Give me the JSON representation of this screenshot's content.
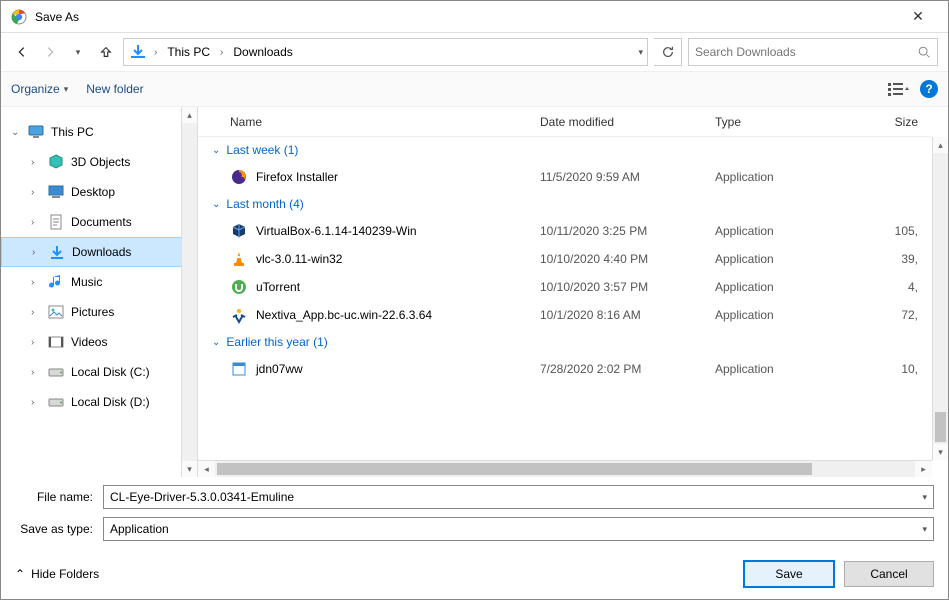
{
  "title": "Save As",
  "breadcrumb": {
    "root": "This PC",
    "item": "Downloads"
  },
  "search": {
    "placeholder": "Search Downloads"
  },
  "toolbar": {
    "organize": "Organize",
    "newfolder": "New folder"
  },
  "tree": [
    {
      "label": "This PC",
      "icon": "pc",
      "level": 1,
      "expand": "v"
    },
    {
      "label": "3D Objects",
      "icon": "3d",
      "level": 2,
      "expand": ">"
    },
    {
      "label": "Desktop",
      "icon": "desktop",
      "level": 2,
      "expand": ">"
    },
    {
      "label": "Documents",
      "icon": "docs",
      "level": 2,
      "expand": ">"
    },
    {
      "label": "Downloads",
      "icon": "down",
      "level": 2,
      "expand": ">",
      "selected": true
    },
    {
      "label": "Music",
      "icon": "music",
      "level": 2,
      "expand": ">"
    },
    {
      "label": "Pictures",
      "icon": "pics",
      "level": 2,
      "expand": ">"
    },
    {
      "label": "Videos",
      "icon": "video",
      "level": 2,
      "expand": ">"
    },
    {
      "label": "Local Disk (C:)",
      "icon": "disk",
      "level": 2,
      "expand": ">"
    },
    {
      "label": "Local Disk (D:)",
      "icon": "disk",
      "level": 2,
      "expand": ">"
    }
  ],
  "columns": {
    "name": "Name",
    "date": "Date modified",
    "type": "Type",
    "size": "Size"
  },
  "groups": [
    {
      "label": "Last week (1)",
      "rows": [
        {
          "name": "Firefox Installer",
          "date": "11/5/2020 9:59 AM",
          "type": "Application",
          "size": "",
          "icon": "ff"
        }
      ]
    },
    {
      "label": "Last month (4)",
      "rows": [
        {
          "name": "VirtualBox-6.1.14-140239-Win",
          "date": "10/11/2020 3:25 PM",
          "type": "Application",
          "size": "105,",
          "icon": "vb"
        },
        {
          "name": "vlc-3.0.11-win32",
          "date": "10/10/2020 4:40 PM",
          "type": "Application",
          "size": "39,",
          "icon": "vlc"
        },
        {
          "name": "uTorrent",
          "date": "10/10/2020 3:57 PM",
          "type": "Application",
          "size": "4,",
          "icon": "ut"
        },
        {
          "name": "Nextiva_App.bc-uc.win-22.6.3.64",
          "date": "10/1/2020 8:16 AM",
          "type": "Application",
          "size": "72,",
          "icon": "nx"
        }
      ]
    },
    {
      "label": "Earlier this year (1)",
      "rows": [
        {
          "name": "jdn07ww",
          "date": "7/28/2020 2:02 PM",
          "type": "Application",
          "size": "10,",
          "icon": "app"
        }
      ]
    }
  ],
  "form": {
    "filename_label": "File name:",
    "filename": "CL-Eye-Driver-5.3.0.0341-Emuline",
    "type_label": "Save as type:",
    "type": "Application"
  },
  "footer": {
    "hidefolders": "Hide Folders",
    "save": "Save",
    "cancel": "Cancel"
  }
}
